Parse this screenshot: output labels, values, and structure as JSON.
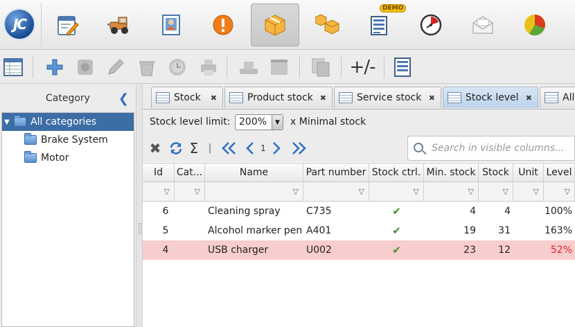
{
  "app": {
    "logo_text": "JC",
    "demo_badge": "DEMO"
  },
  "nav": {
    "items": [
      {
        "name": "documents-icon"
      },
      {
        "name": "vehicle-icon"
      },
      {
        "name": "contacts-icon"
      },
      {
        "name": "alert-icon"
      },
      {
        "name": "box-icon",
        "active": true
      },
      {
        "name": "boxes-icon"
      },
      {
        "name": "list-icon"
      },
      {
        "name": "clock-icon"
      },
      {
        "name": "mail-icon"
      },
      {
        "name": "pie-chart-icon"
      }
    ]
  },
  "toolbar": {
    "plus_minus_label": "+/-"
  },
  "left_panel": {
    "title": "Category",
    "tree": [
      {
        "label": "All categories",
        "selected": true,
        "expanded": true,
        "level": 0
      },
      {
        "label": "Brake System",
        "selected": false,
        "level": 1
      },
      {
        "label": "Motor",
        "selected": false,
        "level": 1
      }
    ]
  },
  "tabs": [
    {
      "label": "Stock",
      "active": false
    },
    {
      "label": "Product stock",
      "active": false
    },
    {
      "label": "Service stock",
      "active": false
    },
    {
      "label": "Stock level",
      "active": true
    },
    {
      "label": "All",
      "active": false
    }
  ],
  "options": {
    "limit_label": "Stock level limit:",
    "limit_value": "200%",
    "limit_suffix": "x Minimal stock"
  },
  "pager": {
    "page": "1",
    "separator": "|",
    "sigma": "Σ"
  },
  "search": {
    "placeholder": "Search in visible columns..."
  },
  "table": {
    "columns": [
      "Id",
      "Cat...",
      "Name",
      "Part number",
      "Stock ctrl.",
      "Min. stock",
      "Stock",
      "Unit",
      "Level"
    ],
    "rows": [
      {
        "id": "6",
        "cat": "",
        "name": "Cleaning spray",
        "part": "C735",
        "ctrl": "✔",
        "min": "4",
        "stock": "4",
        "unit": "",
        "level": "100%",
        "below": false
      },
      {
        "id": "5",
        "cat": "",
        "name": "Alcohol marker pen",
        "part": "A401",
        "ctrl": "✔",
        "min": "19",
        "stock": "31",
        "unit": "",
        "level": "163%",
        "below": false
      },
      {
        "id": "4",
        "cat": "",
        "name": "USB charger",
        "part": "U002",
        "ctrl": "✔",
        "min": "23",
        "stock": "12",
        "unit": "",
        "level": "52%",
        "below": true
      }
    ]
  },
  "colors": {
    "selection": "#3c6ea5",
    "below_limit_row": "#f8cdcd",
    "below_limit_text": "#e0202a",
    "accent": "#2a6fc0"
  }
}
